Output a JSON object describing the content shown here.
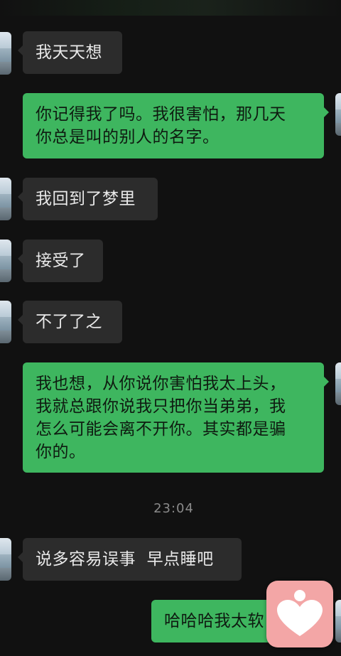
{
  "chat": {
    "messages": [
      {
        "side": "in",
        "text": "我天天想"
      },
      {
        "side": "out",
        "text": "你记得我了吗。我很害怕，那几天\n你总是叫的别人的名字。"
      },
      {
        "side": "in",
        "text": "我回到了梦里"
      },
      {
        "side": "in",
        "text": "接受了"
      },
      {
        "side": "in",
        "text": "不了了之"
      },
      {
        "side": "out",
        "text": "我也想，从你说你害怕我太上头，\n我就总跟你说我只把你当弟弟，我\n怎么可能会离不开你。其实都是骗\n你的。"
      },
      {
        "side": "in",
        "text": "说多容易误事  早点睡吧"
      },
      {
        "side": "out",
        "text": "哈哈哈我太软"
      }
    ],
    "timestamp": "23:04"
  },
  "colors": {
    "background": "#111111",
    "incoming_bubble": "#2c2c2c",
    "outgoing_bubble": "#3eb65f",
    "floating_button": "#f3a6a6"
  },
  "icons": {
    "floating_button": "heart-person-icon"
  }
}
